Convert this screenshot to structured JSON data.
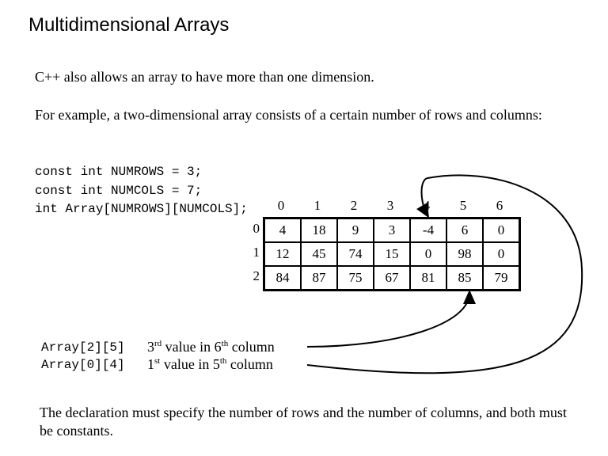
{
  "title": "Multidimensional Arrays",
  "p1": "C++ also allows an array to have more than one dimension.",
  "p2": "For example, a two-dimensional array consists of a certain number of rows and columns:",
  "code": {
    "l1": "const int NUMROWS = 3;",
    "l2": "const int NUMCOLS = 7;",
    "l3": "int Array[NUMROWS][NUMCOLS];"
  },
  "refs": {
    "a": "Array[2][5]",
    "b": "Array[0][4]",
    "adesc_pre": "3",
    "adesc_sup1": "rd",
    "adesc_mid": " value in 6",
    "adesc_sup2": "th",
    "adesc_post": " column",
    "bdesc_pre": "1",
    "bdesc_sup1": "st",
    "bdesc_mid": " value in 5",
    "bdesc_sup2": "th",
    "bdesc_post": " column"
  },
  "p3": "The declaration must specify the number of rows and the number of columns, and both must be constants.",
  "chart_data": {
    "type": "table",
    "col_headers": [
      "0",
      "1",
      "2",
      "3",
      "4",
      "5",
      "6"
    ],
    "row_headers": [
      "0",
      "1",
      "2"
    ],
    "rows": [
      [
        "4",
        "18",
        "9",
        "3",
        "-4",
        "6",
        "0"
      ],
      [
        "12",
        "45",
        "74",
        "15",
        "0",
        "98",
        "0"
      ],
      [
        "84",
        "87",
        "75",
        "67",
        "81",
        "85",
        "79"
      ]
    ]
  }
}
